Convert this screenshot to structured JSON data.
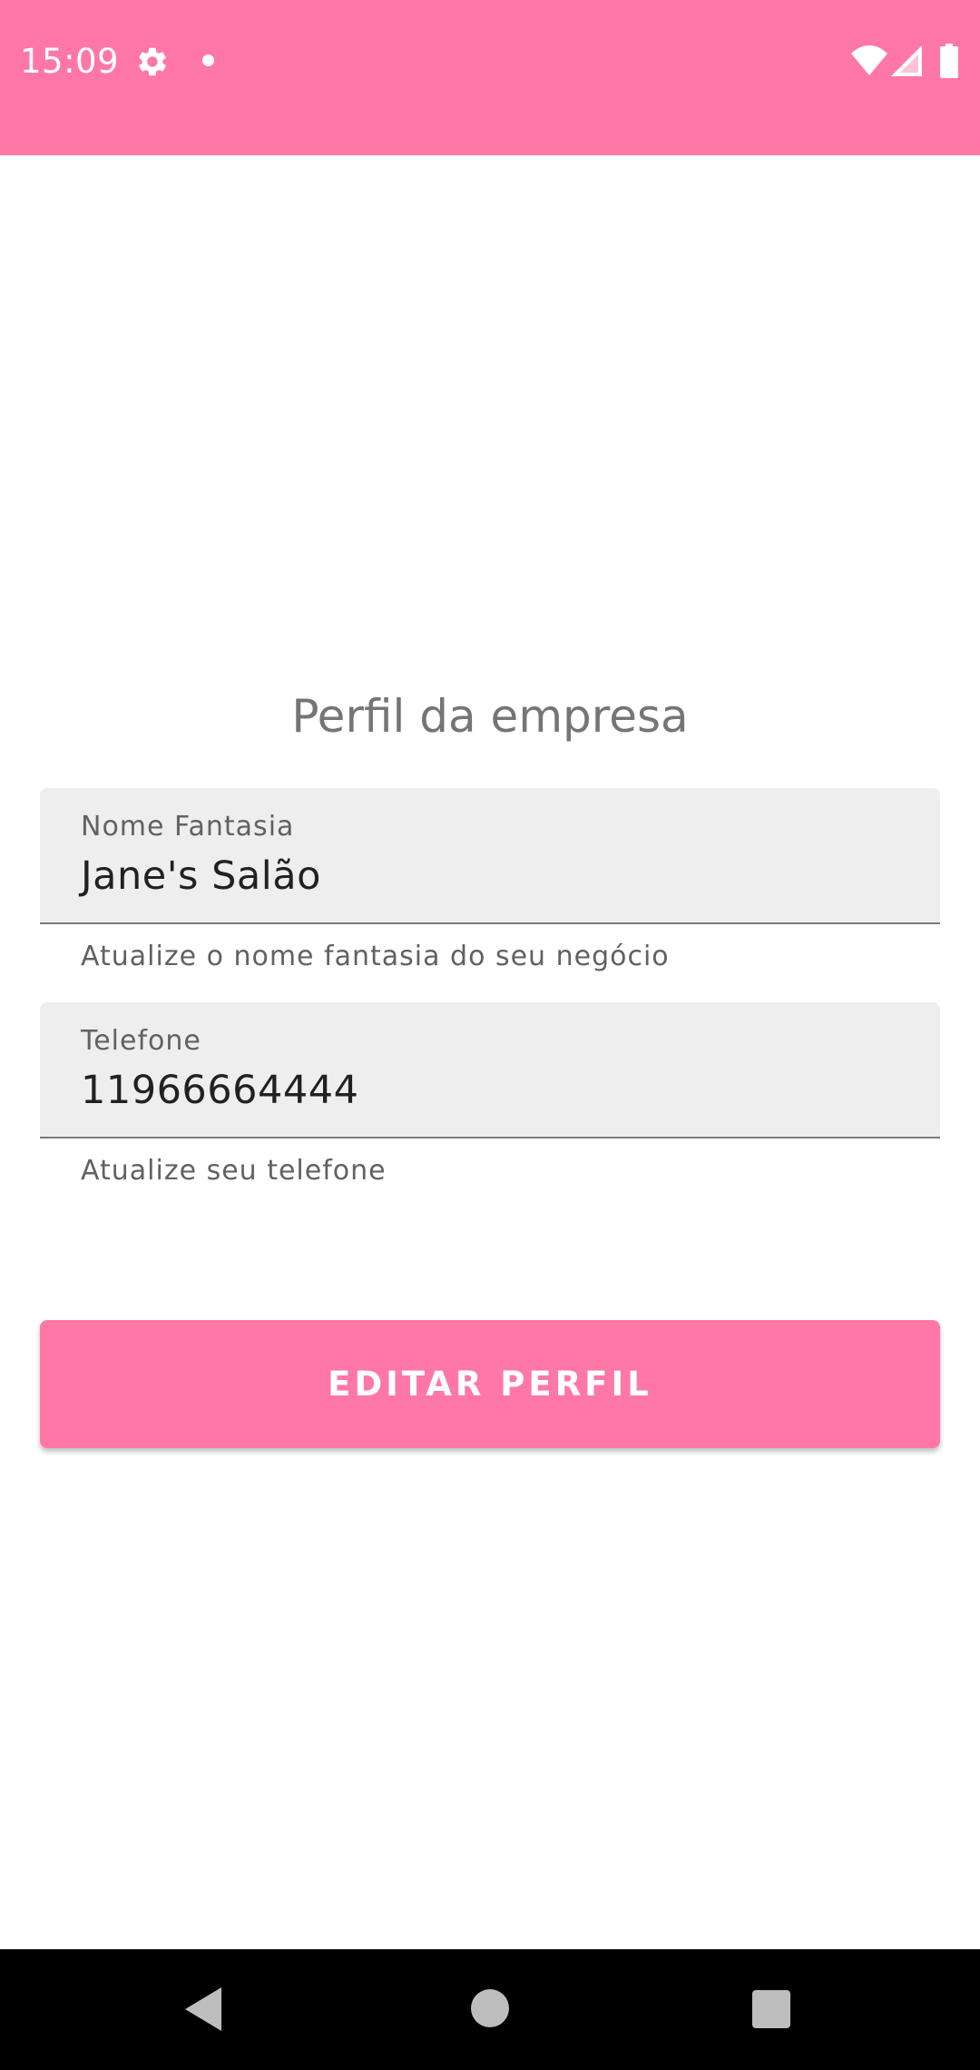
{
  "status_bar": {
    "time": "15:09",
    "icons": [
      "gear-icon",
      "dot-icon",
      "wifi-icon",
      "signal-icon",
      "battery-icon"
    ],
    "background": "#FF77A7"
  },
  "page": {
    "title": "Perfil da empresa"
  },
  "form": {
    "nome": {
      "label": "Nome Fantasia",
      "value": "Jane's Salão",
      "helper": "Atualize o nome fantasia do seu negócio"
    },
    "telefone": {
      "label": "Telefone",
      "value": "11966664444",
      "helper": "Atualize seu telefone"
    }
  },
  "actions": {
    "edit_label": "EDITAR PERFIL",
    "accent_color": "#FF77A7"
  },
  "nav_bar": {
    "icons": [
      "back-icon",
      "home-icon",
      "recents-icon"
    ]
  }
}
